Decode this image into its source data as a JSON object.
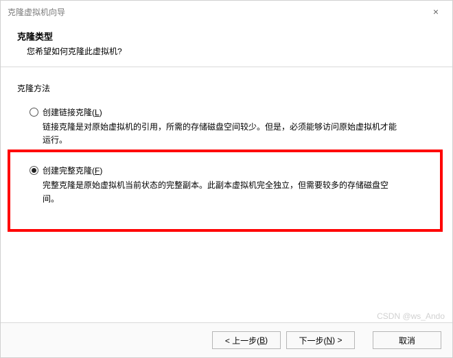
{
  "window": {
    "title": "克隆虚拟机向导",
    "close": "×"
  },
  "header": {
    "title": "克隆类型",
    "subtitle": "您希望如何克隆此虚拟机?"
  },
  "group": {
    "label": "克隆方法"
  },
  "options": {
    "linked": {
      "label_prefix": "创建链接克隆(",
      "mnemonic": "L",
      "label_suffix": ")",
      "desc": "链接克隆是对原始虚拟机的引用，所需的存储磁盘空间较少。但是，必须能够访问原始虚拟机才能运行。"
    },
    "full": {
      "label_prefix": "创建完整克隆(",
      "mnemonic": "F",
      "label_suffix": ")",
      "desc": "完整克隆是原始虚拟机当前状态的完整副本。此副本虚拟机完全独立，但需要较多的存储磁盘空间。"
    }
  },
  "footer": {
    "back_prefix": "< 上一步(",
    "back_mnemonic": "B",
    "back_suffix": ")",
    "next_prefix": "下一步(",
    "next_mnemonic": "N",
    "next_suffix": ") >",
    "cancel": "取消"
  },
  "watermark": "CSDN @ws_Ando"
}
